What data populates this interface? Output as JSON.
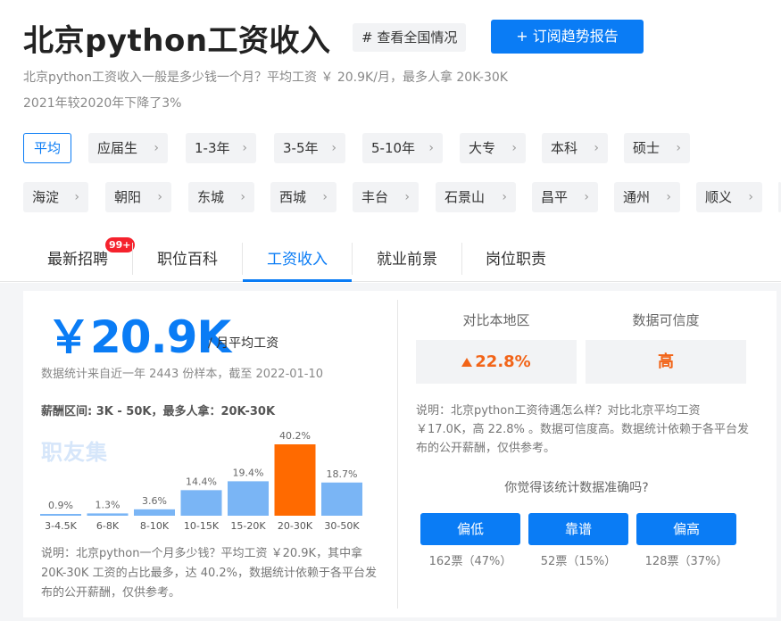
{
  "header": {
    "title": "北京python工资收入",
    "national_btn": "# 查看全国情况",
    "subscribe_btn": "+ 订阅趋势报告"
  },
  "summary": {
    "line1": "北京python工资收入一般是多少钱一个月？平均工资 ￥ 20.9K/月，最多人拿 20K-30K",
    "line2": "2021年较2020年下降了3%"
  },
  "filters": {
    "experience": [
      "平均",
      "应届生",
      "1-3年",
      "3-5年",
      "5-10年",
      "大专",
      "本科",
      "硕士"
    ],
    "districts": [
      "海淀",
      "朝阳",
      "东城",
      "西城",
      "丰台",
      "石景山",
      "昌平",
      "通州",
      "顺义"
    ],
    "chevron": "chevron-right-icon"
  },
  "tabs": {
    "items": [
      "最新招聘",
      "职位百科",
      "工资收入",
      "就业前景",
      "岗位职责"
    ],
    "active": "工资收入",
    "badge": "99+"
  },
  "salary": {
    "average": "￥20.9K",
    "unit": "/ 月平均工资",
    "stat_note": "数据统计来自近一年 2443 份样本，截至 2022-01-10",
    "range_text": "薪酬区间: 3K - 50K，最多人拿：20K-30K",
    "watermark": "职友集",
    "note": "说明：北京python一个月多少钱？平均工资 ￥20.9K，其中拿20K-30K 工资的占比最多，达 40.2%，数据统计依赖于各平台发布的公开薪酬，仅供参考。"
  },
  "chart_data": {
    "type": "bar",
    "categories": [
      "3-4.5K",
      "6-8K",
      "8-10K",
      "10-15K",
      "15-20K",
      "20-30K",
      "30-50K"
    ],
    "values": [
      0.9,
      1.3,
      3.6,
      14.4,
      19.4,
      40.2,
      18.7
    ],
    "labels": [
      "0.9%",
      "1.3%",
      "3.6%",
      "14.4%",
      "19.4%",
      "40.2%",
      "18.7%"
    ],
    "highlight_index": 5,
    "ylim": [
      0,
      40.2
    ],
    "colors": {
      "bar": "#7ab5f5",
      "highlight": "#ff6a00"
    }
  },
  "compare": {
    "region_label": "对比本地区",
    "region_value": "22.8%",
    "credibility_label": "数据可信度",
    "credibility_value": "高",
    "note": "说明：北京python工资待遇怎么样？对比北京平均工资 ￥17.0K，高 22.8% 。数据可信度高。数据统计依赖于各平台发布的公开薪酬，仅供参考。",
    "question": "你觉得该统计数据准确吗?",
    "votes": [
      {
        "label": "偏低",
        "count": "162票（47%）"
      },
      {
        "label": "靠谱",
        "count": "52票（15%）"
      },
      {
        "label": "偏高",
        "count": "128票（37%）"
      }
    ]
  },
  "colors": {
    "accent": "#0a7cf5",
    "orange": "#f26418"
  }
}
